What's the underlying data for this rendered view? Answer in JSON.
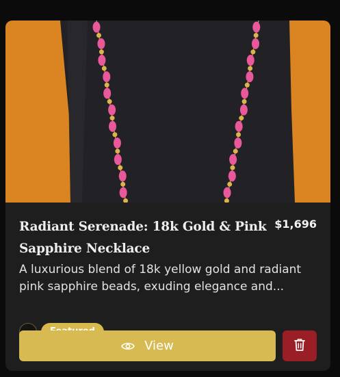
{
  "product": {
    "title": "Radiant Serenade: 18k Gold & Pink Sapphire Necklace",
    "price": "$1,696",
    "description": "A luxurious blend of 18k yellow gold and radiant pink sapphire beads, exuding elegance and...",
    "badge": "Featured",
    "image_icon": "necklace-photo"
  },
  "actions": {
    "view_label": "View",
    "view_icon": "eye-icon",
    "delete_icon": "trash-icon"
  },
  "colors": {
    "card_bg": "#1e1e1e",
    "accent_gold": "#d8ba52",
    "delete_red": "#9a1e25"
  }
}
